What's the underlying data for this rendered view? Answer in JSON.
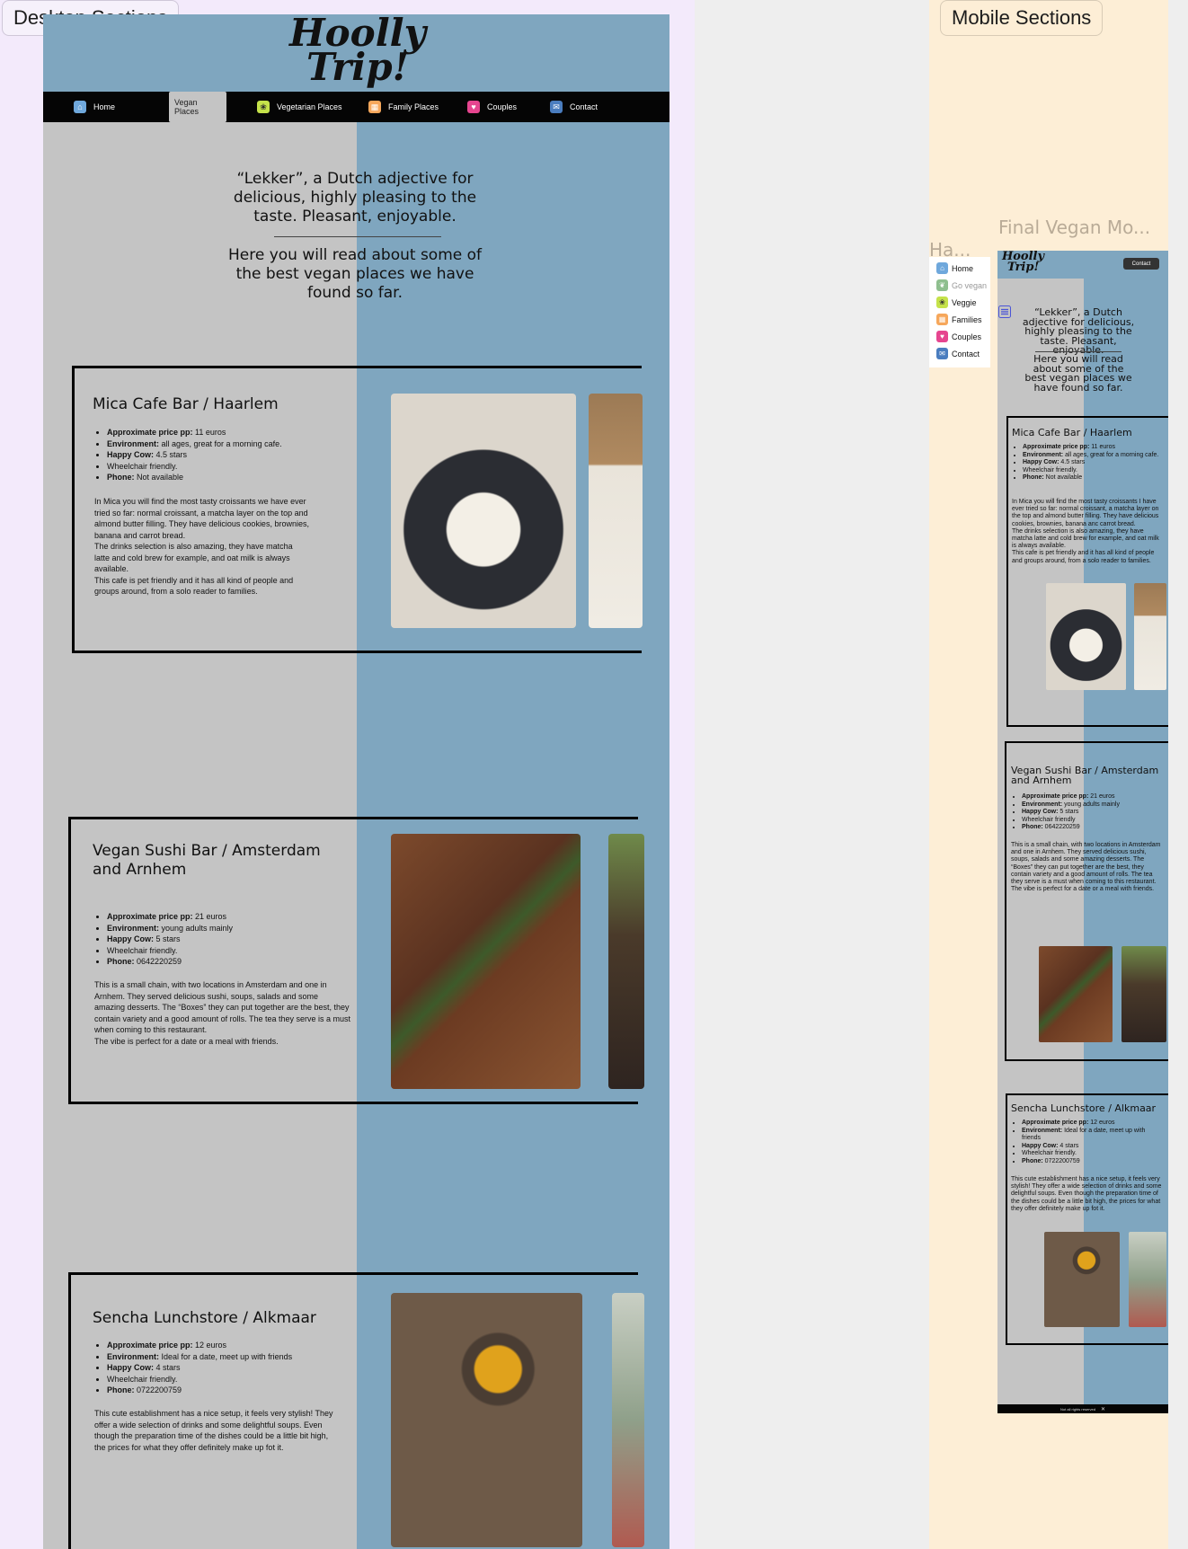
{
  "canvas": {
    "desktop_label": "Desktop Sections",
    "mobile_label": "Mobile Sections",
    "mobile_frame_title": "Final Vegan Mo...",
    "menu_frame_title": "Ha..."
  },
  "site": {
    "logo_line1": "Hoolly",
    "logo_line2": "Trip!",
    "intro_1": "“Lekker”, a Dutch adjective for delicious, highly pleasing to the taste. Pleasant, enjoyable.",
    "intro_2": "Here you will read about some of the best vegan places we have found so far.",
    "footer": "Not all rights reserved"
  },
  "nav": [
    {
      "label": "Home",
      "icon": "house-icon",
      "color": "#6fa8dc",
      "glyph": "⌂"
    },
    {
      "label": "Vegan Places",
      "icon": "leaf-icon",
      "color": "#8fbf8f",
      "glyph": "❦"
    },
    {
      "label": "Vegetarian Places",
      "icon": "broccoli-icon",
      "color": "#c5e24a",
      "glyph": "❀"
    },
    {
      "label": "Family Places",
      "icon": "family-icon",
      "color": "#f6a75b",
      "glyph": "▦"
    },
    {
      "label": "Couples",
      "icon": "couple-icon",
      "color": "#e6458f",
      "glyph": "♥"
    },
    {
      "label": "Contact",
      "icon": "chat-icon",
      "color": "#4a7dbf",
      "glyph": "✉"
    }
  ],
  "mobile_menu": [
    {
      "label": "Home",
      "icon": "house-icon",
      "color": "#6fa8dc",
      "glyph": "⌂"
    },
    {
      "label": "Go vegan",
      "icon": "leaf-icon",
      "color": "#8fbf8f",
      "glyph": "❦"
    },
    {
      "label": "Veggie",
      "icon": "broccoli-icon",
      "color": "#c5e24a",
      "glyph": "❀"
    },
    {
      "label": "Families",
      "icon": "family-icon",
      "color": "#f6a75b",
      "glyph": "▦"
    },
    {
      "label": "Couples",
      "icon": "couple-icon",
      "color": "#e6458f",
      "glyph": "♥"
    },
    {
      "label": "Contact",
      "icon": "chat-icon",
      "color": "#4a7dbf",
      "glyph": "✉"
    }
  ],
  "mobile_header": {
    "contact_button": "Contact",
    "hamburger_icon": "hamburger-icon"
  },
  "places": [
    {
      "title": "Mica Cafe Bar / Haarlem",
      "price_label": "Approximate price pp:",
      "price": " 11 euros",
      "env_label": "Environment:",
      "env": " all ages, great for a morning cafe.",
      "cow_label": "Happy Cow:",
      "cow": " 4.5 stars",
      "wheelchair": "Wheelchair friendly.",
      "phone_label": "Phone:",
      "phone": " Not available",
      "body": "In Mica you will find the most tasty croissants we have ever tried so far: normal croissant, a matcha layer on the top and almond butter filling. They have delicious cookies, brownies, banana and carrot bread.\nThe drinks selection is also amazing, they have matcha latte and cold brew for example, and oat milk is always available.\nThis cafe is pet friendly and it has all kind of people and groups around, from a solo reader to families."
    },
    {
      "title": "Vegan Sushi Bar / Amsterdam and Arnhem",
      "price_label": "Approximate price pp:",
      "price": " 21 euros",
      "env_label": "Environment:",
      "env": " young adults mainly",
      "cow_label": "Happy Cow:",
      "cow": " 5 stars",
      "wheelchair": "Wheelchair friendly.",
      "phone_label": "Phone:",
      "phone": " 0642220259",
      "body": "This is a small chain, with two locations in Amsterdam and one in Arnhem. They served delicious sushi, soups, salads and some amazing desserts. The “Boxes” they can put together are the best, they contain variety and a good amount of rolls. The tea they serve is a must when coming to this restaurant.\nThe vibe is perfect for a date or a meal with friends."
    },
    {
      "title": "Sencha Lunchstore / Alkmaar",
      "price_label": "Approximate price pp:",
      "price": " 12 euros",
      "env_label": "Environment:",
      "env": " Ideal for a date, meet up with friends",
      "cow_label": "Happy Cow:",
      "cow": " 4 stars",
      "wheelchair": "Wheelchair friendly.",
      "phone_label": "Phone:",
      "phone": " 0722200759",
      "body": "This cute establishment has a nice setup, it feels very stylish! They offer a wide selection of drinks and some delightful soups. Even though the preparation time of the dishes could be a little bit high, the prices for what they offer definitely make up fot it."
    }
  ],
  "mobile_places": [
    {
      "title": "Mica Cafe Bar / Haarlem",
      "price_label": "Approximate price pp:",
      "price": " 11 euros",
      "env_label": "Environment:",
      "env": " all ages, great for a morning cafe.",
      "cow_label": "Happy Cow:",
      "cow": " 4.5 stars",
      "wheelchair": "Wheelchair friendly.",
      "phone_label": "Phone:",
      "phone": " Not available",
      "body": "In Mica you will find the most tasty croissants I have ever tried so far: normal croissant, a matcha layer on the top and almond butter filling. They have delicious cookies, brownies, banana anc carrot bread.\nThe drinks selection is also amazing, they have matcha latte and cold brew for example, and oat milk is always available.\nThis cafe is pet friendly and it has all kind of people and groups around, from a solo reader to families."
    },
    {
      "title": "Vegan Sushi Bar / Amsterdam and Arnhem",
      "price_label": "Approximate price pp:",
      "price": " 21 euros",
      "env_label": "Environment:",
      "env": " young adults mainly",
      "cow_label": "Happy Cow:",
      "cow": " 5 stars",
      "wheelchair": "Wheelchair friendly",
      "phone_label": "Phone:",
      "phone": " 0642220259",
      "body": "This is a small chain, with two locations in Amsterdam and one in Arnhem. They served delicious sushi, soups, salads and some amazing desserts. The “Boxes” they can put together are the best, they contain variety and a good amount of rolls. The tea they serve is a must when coming to this restaurant.\nThe vibe is perfect for a date or a meal with friends."
    },
    {
      "title": "Sencha Lunchstore / Alkmaar",
      "price_label": "Approximate price pp:",
      "price": " 12 euros",
      "env_label": "Environment:",
      "env": " Ideal for a date, meet up with friends",
      "cow_label": "Happy Cow:",
      "cow": " 4 stars",
      "wheelchair": "Wheelchair friendly.",
      "phone_label": "Phone:",
      "phone": " 0722200759",
      "body": "This cute establishment has a nice setup, it feels very stylish! They offer a wide selection of drinks and some delightful soups. Even though the preparation time of the dishes could be a little bit high, the prices for what they offer definitely make up fot it."
    }
  ]
}
